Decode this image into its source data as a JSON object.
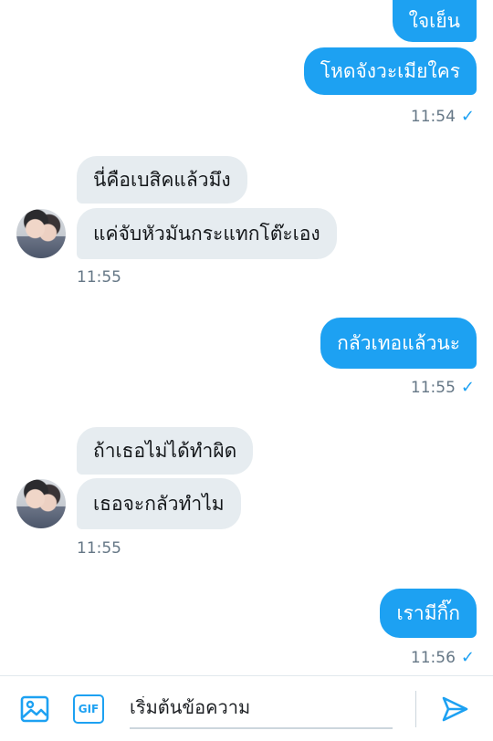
{
  "messages": [
    {
      "id": "m1",
      "side": "out",
      "text": "ใจเย็น"
    },
    {
      "id": "m2",
      "side": "out",
      "text": "โหดจังวะเมียใคร"
    },
    {
      "id": "m3",
      "side": "in",
      "text": "นี่คือเบสิคแล้วมึง"
    },
    {
      "id": "m4",
      "side": "in",
      "text": "แค่จับหัวมันกระแทกโต๊ะเอง"
    },
    {
      "id": "m5",
      "side": "out",
      "text": "กลัวเทอแล้วนะ"
    },
    {
      "id": "m6",
      "side": "in",
      "text": "ถ้าเธอไม่ได้ทำผิด"
    },
    {
      "id": "m7",
      "side": "in",
      "text": "เธอจะกลัวทำไม"
    },
    {
      "id": "m8",
      "side": "out",
      "text": "เรามีกิ๊ก"
    }
  ],
  "timestamps": {
    "t1": "11:54",
    "t2": "11:55",
    "t3": "11:55",
    "t4": "11:55",
    "t5": "11:56"
  },
  "read_mark": "✓",
  "composer": {
    "placeholder": "เริ่มต้นข้อความ",
    "gif_label": "GIF",
    "icons": [
      "image-icon",
      "gif-icon",
      "send-icon"
    ]
  },
  "colors": {
    "accent": "#1da1f2",
    "incoming_bubble": "#e6ecf0",
    "timestamp": "#657786"
  }
}
